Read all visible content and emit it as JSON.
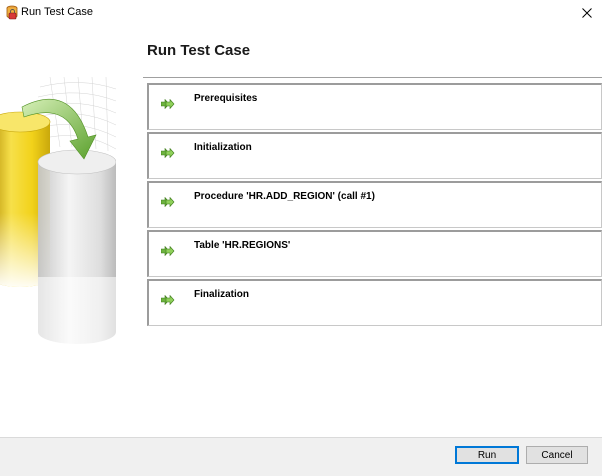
{
  "window": {
    "title": "Run Test Case",
    "app_icon": "database-lock-icon",
    "close_glyph": "✕"
  },
  "heading": "Run Test Case",
  "illustration": "cylinders-copy-illustration",
  "steps": [
    {
      "label": "Prerequisites",
      "icon": "double-arrow-icon"
    },
    {
      "label": "Initialization",
      "icon": "double-arrow-icon"
    },
    {
      "label": "Procedure 'HR.ADD_REGION' (call #1)",
      "icon": "double-arrow-icon"
    },
    {
      "label": "Table 'HR.REGIONS'",
      "icon": "double-arrow-icon"
    },
    {
      "label": "Finalization",
      "icon": "double-arrow-icon"
    }
  ],
  "buttons": {
    "run": "Run",
    "cancel": "Cancel"
  },
  "colors": {
    "accent": "#0078d7",
    "arrow_green": "#5aa02c",
    "cylinder_yellow": "#f2d21a"
  }
}
